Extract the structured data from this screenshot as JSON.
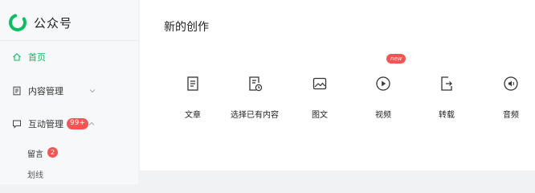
{
  "brand": {
    "name": "公众号",
    "logo_icon": "wechat-official-account-logo",
    "accent": "#07c160"
  },
  "sidebar": {
    "items": [
      {
        "label": "首页",
        "icon": "home-icon",
        "active": true
      },
      {
        "label": "内容管理",
        "icon": "document-icon",
        "expanded": false
      },
      {
        "label": "互动管理",
        "icon": "chat-icon",
        "expanded": true,
        "badge": "99+"
      }
    ],
    "sub_items": [
      {
        "label": "留言",
        "badge": "2"
      },
      {
        "label": "划线"
      }
    ]
  },
  "create": {
    "title": "新的创作",
    "new_badge": "new",
    "items": [
      {
        "label": "文章",
        "icon": "article-icon"
      },
      {
        "label": "选择已有内容",
        "icon": "history-document-icon"
      },
      {
        "label": "图文",
        "icon": "image-icon"
      },
      {
        "label": "视频",
        "icon": "video-play-icon"
      },
      {
        "label": "转载",
        "icon": "repost-icon"
      },
      {
        "label": "音频",
        "icon": "audio-icon"
      }
    ]
  },
  "colors": {
    "badge": "#fa5151",
    "sidebar_bg": "#f7f8f9",
    "page_bg": "#f1f2f3"
  }
}
